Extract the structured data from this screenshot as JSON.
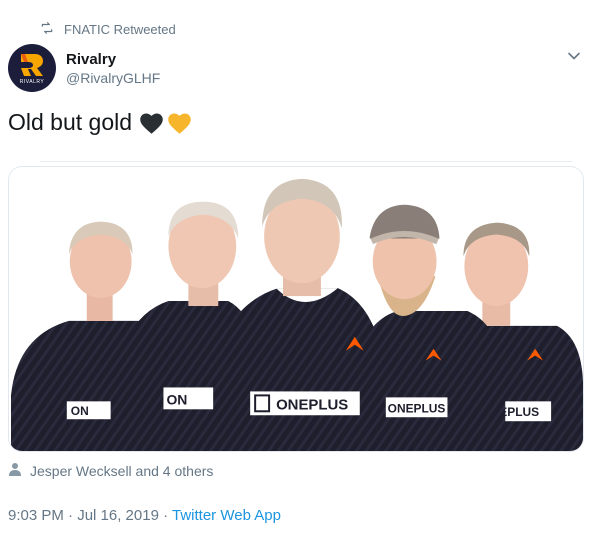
{
  "retweet": {
    "icon": "retweet-icon",
    "text": "FNATIC Retweeted"
  },
  "author": {
    "display_name": "Rivalry",
    "handle": "@RivalryGLHF",
    "avatar_icon": "rivalry-logo",
    "avatar_text": "RIVALRY"
  },
  "menu": {
    "icon": "chevron-down-icon"
  },
  "tweet": {
    "text": "Old but gold",
    "emojis": [
      "black-heart",
      "yellow-heart"
    ]
  },
  "media": {
    "description_icon": "photo",
    "jersey_text": [
      "ON",
      "ON",
      "ONEPLUS",
      "ONEPLUS",
      "EPLUS"
    ]
  },
  "likers": {
    "icon": "person-icon",
    "text": "Jesper Wecksell and 4 others"
  },
  "meta": {
    "timestamp": "9:03 PM · Jul 16, 2019",
    "separator": " · ",
    "app": "Twitter Web App"
  },
  "colors": {
    "text_primary": "#14171a",
    "text_secondary": "#657786",
    "link": "#1b95e0",
    "heart_yellow": "#f7b52b",
    "heart_black": "#292f33",
    "jersey": "#1e1e2c",
    "fnatic_orange": "#ff5900"
  }
}
